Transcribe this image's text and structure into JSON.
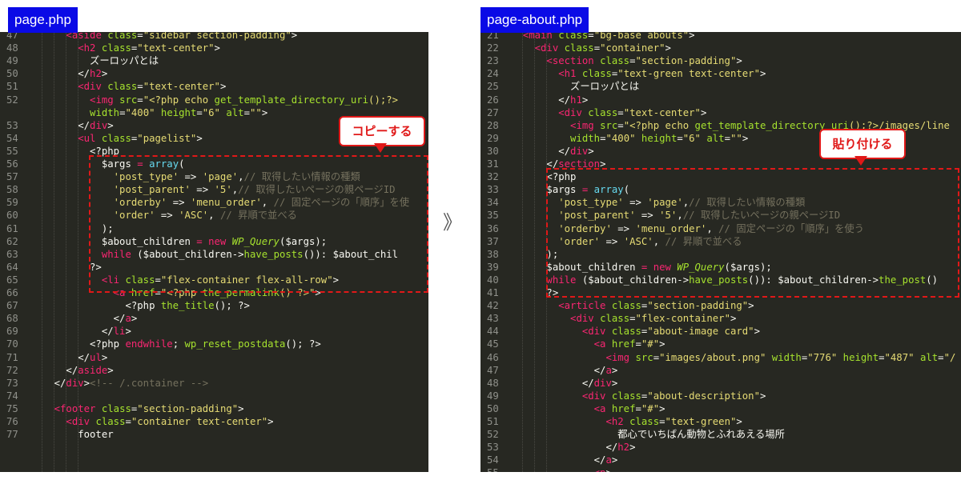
{
  "left": {
    "filename": "page.php",
    "callout": "コピーする",
    "lines": [
      {
        "n": "47",
        "html": "      <span class='t'>&lt;aside</span> <span class='a'>class</span>=<span class='s'>\"sidebar section-padding\"</span>&gt;"
      },
      {
        "n": "48",
        "html": "        <span class='t'>&lt;h2</span> <span class='a'>class</span>=<span class='s'>\"text-center\"</span>&gt;"
      },
      {
        "n": "49",
        "html": "          ズーロッパとは"
      },
      {
        "n": "50",
        "html": "        &lt;/<span class='t'>h2</span>&gt;"
      },
      {
        "n": "51",
        "html": "        <span class='t'>&lt;div</span> <span class='a'>class</span>=<span class='s'>\"text-center\"</span>&gt;"
      },
      {
        "n": "52",
        "html": "          <span class='t'>&lt;img</span> <span class='a'>src</span>=<span class='s'>\"&lt;?php echo <span class='a'>get_template_directory_uri</span>();?&gt;</span>"
      },
      {
        "n": "",
        "html": "          <span class='a'>width</span>=<span class='s'>\"400\"</span> <span class='a'>height</span>=<span class='s'>\"6\"</span> <span class='a'>alt</span>=<span class='s'>\"\"</span>&gt;"
      },
      {
        "n": "53",
        "html": "        &lt;/<span class='t'>div</span>&gt;"
      },
      {
        "n": "54",
        "html": "        <span class='t'>&lt;ul</span> <span class='a'>class</span>=<span class='s'>\"pagelist\"</span>&gt;"
      },
      {
        "n": "55",
        "html": "          &lt;?php"
      },
      {
        "n": "56",
        "html": "            $args <span class='kw'>=</span> <span class='k'>array</span>("
      },
      {
        "n": "57",
        "html": "              <span class='s'>'post_type'</span> =&gt; <span class='s'>'page'</span>,<span class='c'>// 取得したい情報の種類</span>"
      },
      {
        "n": "58",
        "html": "              <span class='s'>'post_parent'</span> =&gt; <span class='s'>'5'</span>,<span class='c'>// 取得したいページの親ページID</span>"
      },
      {
        "n": "59",
        "html": "              <span class='s'>'orderby'</span> =&gt; <span class='s'>'menu_order'</span>, <span class='c'>// 固定ページの「順序」を使</span>"
      },
      {
        "n": "60",
        "html": "              <span class='s'>'order'</span> =&gt; <span class='s'>'ASC'</span>, <span class='c'>// 昇順で並べる</span>"
      },
      {
        "n": "61",
        "html": "            );"
      },
      {
        "n": "62",
        "html": "            $about_children <span class='kw'>=</span> <span class='kw'>new</span> <span class='cls'>WP_Query</span>($args);"
      },
      {
        "n": "63",
        "html": "            <span class='kw'>while</span> ($about_children-&gt;<span class='a'>have_posts</span>()): $about_chil"
      },
      {
        "n": "64",
        "html": "          ?&gt;"
      },
      {
        "n": "65",
        "html": "            <span class='t'>&lt;li</span> <span class='a'>class</span>=<span class='s'>\"flex-container flex-all-row\"</span>&gt;"
      },
      {
        "n": "66",
        "html": "              <span class='t'>&lt;a</span> <span class='a'>href</span>=<span class='s'>\"&lt;?php <span class='a'>the_permalink</span>() ?&gt;\"</span>&gt;"
      },
      {
        "n": "67",
        "html": "                &lt;?php <span class='a'>the_title</span>(); ?&gt;"
      },
      {
        "n": "68",
        "html": "              &lt;/<span class='t'>a</span>&gt;"
      },
      {
        "n": "69",
        "html": "            &lt;/<span class='t'>li</span>&gt;"
      },
      {
        "n": "70",
        "html": "          &lt;?php <span class='kw'>endwhile</span>; <span class='a'>wp_reset_postdata</span>(); ?&gt;"
      },
      {
        "n": "71",
        "html": "        &lt;/<span class='t'>ul</span>&gt;"
      },
      {
        "n": "72",
        "html": "      &lt;/<span class='t'>aside</span>&gt;"
      },
      {
        "n": "73",
        "html": "    &lt;/<span class='t'>div</span>&gt;<span class='c'>&lt;!-- /.container --&gt;</span>"
      },
      {
        "n": "74",
        "html": ""
      },
      {
        "n": "75",
        "html": "    <span class='t'>&lt;footer</span> <span class='a'>class</span>=<span class='s'>\"section-padding\"</span>&gt;"
      },
      {
        "n": "76",
        "html": "      <span class='t'>&lt;div</span> <span class='a'>class</span>=<span class='s'>\"container text-center\"</span>&gt;"
      },
      {
        "n": "77",
        "html": "        footer"
      }
    ]
  },
  "right": {
    "filename": "page-about.php",
    "callout": "貼り付ける",
    "lines": [
      {
        "n": "21",
        "html": "  <span class='t'>&lt;main</span> <span class='a'>class</span>=<span class='s'>\"bg-base abouts\"</span>&gt;"
      },
      {
        "n": "22",
        "html": "    <span class='t'>&lt;div</span> <span class='a'>class</span>=<span class='s'>\"container\"</span>&gt;"
      },
      {
        "n": "23",
        "html": "      <span class='t'>&lt;section</span> <span class='a'>class</span>=<span class='s'>\"section-padding\"</span>&gt;"
      },
      {
        "n": "24",
        "html": "        <span class='t'>&lt;h1</span> <span class='a'>class</span>=<span class='s'>\"text-green text-center\"</span>&gt;"
      },
      {
        "n": "25",
        "html": "          ズーロッパとは"
      },
      {
        "n": "26",
        "html": "        &lt;/<span class='t'>h1</span>&gt;"
      },
      {
        "n": "27",
        "html": "        <span class='t'>&lt;div</span> <span class='a'>class</span>=<span class='s'>\"text-center\"</span>&gt;"
      },
      {
        "n": "28",
        "html": "          <span class='t'>&lt;img</span> <span class='a'>src</span>=<span class='s'>\"&lt;?php echo <span class='a'>get_template_directory_uri</span>();?&gt;/images/line</span>"
      },
      {
        "n": "29",
        "html": "          <span class='a'>width</span>=<span class='s'>\"400\"</span> <span class='a'>height</span>=<span class='s'>\"6\"</span> <span class='a'>alt</span>=<span class='s'>\"\"</span>&gt;"
      },
      {
        "n": "30",
        "html": "        &lt;/<span class='t'>div</span>&gt;"
      },
      {
        "n": "31",
        "html": "      &lt;/<span class='t'>section</span>&gt;"
      },
      {
        "n": "32",
        "html": "      &lt;?php"
      },
      {
        "n": "33",
        "html": "      $args <span class='kw'>=</span> <span class='k'>array</span>("
      },
      {
        "n": "34",
        "html": "        <span class='s'>'post_type'</span> =&gt; <span class='s'>'page'</span>,<span class='c'>// 取得したい情報の種類</span>"
      },
      {
        "n": "35",
        "html": "        <span class='s'>'post_parent'</span> =&gt; <span class='s'>'5'</span>,<span class='c'>// 取得したいページの親ページID</span>"
      },
      {
        "n": "36",
        "html": "        <span class='s'>'orderby'</span> =&gt; <span class='s'>'menu_order'</span>, <span class='c'>// 固定ページの「順序」を使う</span>"
      },
      {
        "n": "37",
        "html": "        <span class='s'>'order'</span> =&gt; <span class='s'>'ASC'</span>, <span class='c'>// 昇順で並べる</span>"
      },
      {
        "n": "38",
        "html": "      );"
      },
      {
        "n": "39",
        "html": "      $about_children <span class='kw'>=</span> <span class='kw'>new</span> <span class='cls'>WP_Query</span>($args);"
      },
      {
        "n": "40",
        "html": "      <span class='kw'>while</span> ($about_children-&gt;<span class='a'>have_posts</span>()): $about_children-&gt;<span class='a'>the_post</span>()"
      },
      {
        "n": "41",
        "html": "      ?&gt;"
      },
      {
        "n": "42",
        "html": "        <span class='t'>&lt;article</span> <span class='a'>class</span>=<span class='s'>\"section-padding\"</span>&gt;"
      },
      {
        "n": "43",
        "html": "          <span class='t'>&lt;div</span> <span class='a'>class</span>=<span class='s'>\"flex-container\"</span>&gt;"
      },
      {
        "n": "44",
        "html": "            <span class='t'>&lt;div</span> <span class='a'>class</span>=<span class='s'>\"about-image card\"</span>&gt;"
      },
      {
        "n": "45",
        "html": "              <span class='t'>&lt;a</span> <span class='a'>href</span>=<span class='s'>\"#\"</span>&gt;"
      },
      {
        "n": "46",
        "html": "                <span class='t'>&lt;img</span> <span class='a'>src</span>=<span class='s'>\"images/about.png\"</span> <span class='a'>width</span>=<span class='s'>\"776\"</span> <span class='a'>height</span>=<span class='s'>\"487\"</span> <span class='a'>alt</span>=<span class='s'>\"/</span>"
      },
      {
        "n": "47",
        "html": "              &lt;/<span class='t'>a</span>&gt;"
      },
      {
        "n": "48",
        "html": "            &lt;/<span class='t'>div</span>&gt;"
      },
      {
        "n": "49",
        "html": "            <span class='t'>&lt;div</span> <span class='a'>class</span>=<span class='s'>\"about-description\"</span>&gt;"
      },
      {
        "n": "50",
        "html": "              <span class='t'>&lt;a</span> <span class='a'>href</span>=<span class='s'>\"#\"</span>&gt;"
      },
      {
        "n": "51",
        "html": "                <span class='t'>&lt;h2</span> <span class='a'>class</span>=<span class='s'>\"text-green\"</span>&gt;"
      },
      {
        "n": "52",
        "html": "                  都心でいちばん動物とふれあえる場所"
      },
      {
        "n": "53",
        "html": "                &lt;/<span class='t'>h2</span>&gt;"
      },
      {
        "n": "54",
        "html": "              &lt;/<span class='t'>a</span>&gt;"
      },
      {
        "n": "55",
        "html": "              <span class='t'>&lt;p</span>&gt;"
      }
    ]
  },
  "arrow_glyph": "》",
  "colors": {
    "editor_bg": "#272822",
    "label_bg": "#0a0ae6",
    "highlight": "#e01818"
  }
}
